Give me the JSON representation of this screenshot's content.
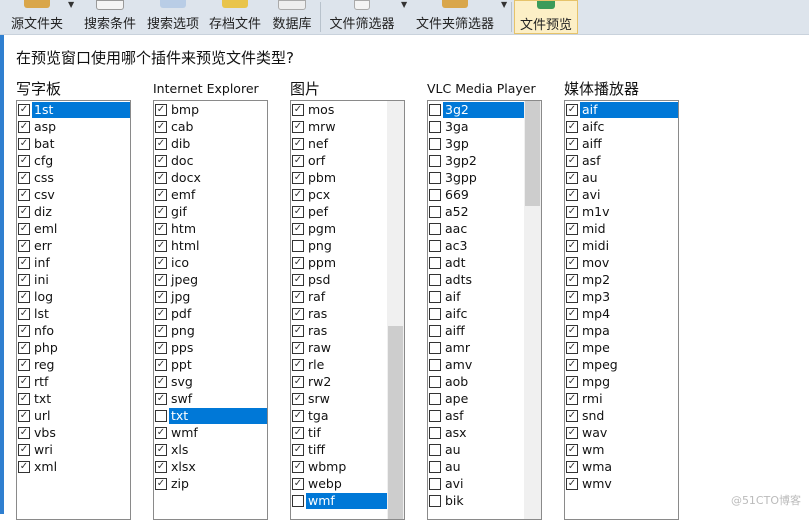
{
  "toolbar": {
    "items": [
      {
        "label": "源文件夹",
        "icon": "folder-search-icon"
      },
      {
        "label": "搜索条件",
        "icon": "search-icon"
      },
      {
        "label": "搜索选项",
        "icon": "gear-icon"
      },
      {
        "label": "存档文件",
        "icon": "archive-icon"
      },
      {
        "label": "数据库",
        "icon": "database-icon"
      },
      {
        "label": "文件筛选器",
        "icon": "filter-icon"
      },
      {
        "label": "文件夹筛选器",
        "icon": "folder-filter-icon"
      },
      {
        "label": "文件预览",
        "icon": "preview-icon"
      }
    ]
  },
  "question": "在预览窗口使用哪个插件来预览文件类型?",
  "groups": [
    {
      "title": "写字板",
      "items": [
        [
          "1st",
          1,
          1
        ],
        [
          "asp",
          1
        ],
        [
          "bat",
          1
        ],
        [
          "cfg",
          1
        ],
        [
          "css",
          1
        ],
        [
          "csv",
          1
        ],
        [
          "diz",
          1
        ],
        [
          "eml",
          1
        ],
        [
          "err",
          1
        ],
        [
          "inf",
          1
        ],
        [
          "ini",
          1
        ],
        [
          "log",
          1
        ],
        [
          "lst",
          1
        ],
        [
          "nfo",
          1
        ],
        [
          "php",
          1
        ],
        [
          "reg",
          1
        ],
        [
          "rtf",
          1
        ],
        [
          "txt",
          1
        ],
        [
          "url",
          1
        ],
        [
          "vbs",
          1
        ],
        [
          "wri",
          1
        ],
        [
          "xml",
          1
        ]
      ]
    },
    {
      "title": "Internet Explorer",
      "items": [
        [
          "bmp",
          1
        ],
        [
          "cab",
          1
        ],
        [
          "dib",
          1
        ],
        [
          "doc",
          1
        ],
        [
          "docx",
          1
        ],
        [
          "emf",
          1
        ],
        [
          "gif",
          1
        ],
        [
          "htm",
          1
        ],
        [
          "html",
          1
        ],
        [
          "ico",
          1
        ],
        [
          "jpeg",
          1
        ],
        [
          "jpg",
          1
        ],
        [
          "pdf",
          1
        ],
        [
          "png",
          1
        ],
        [
          "pps",
          1
        ],
        [
          "ppt",
          1
        ],
        [
          "svg",
          1
        ],
        [
          "swf",
          1
        ],
        [
          "txt",
          0,
          1
        ],
        [
          "wmf",
          1
        ],
        [
          "xls",
          1
        ],
        [
          "xlsx",
          1
        ],
        [
          "zip",
          1
        ]
      ]
    },
    {
      "title": "图片",
      "items": [
        [
          "mos",
          1
        ],
        [
          "mrw",
          1
        ],
        [
          "nef",
          1
        ],
        [
          "orf",
          1
        ],
        [
          "pbm",
          1
        ],
        [
          "pcx",
          1
        ],
        [
          "pef",
          1
        ],
        [
          "pgm",
          1
        ],
        [
          "png",
          0
        ],
        [
          "ppm",
          1
        ],
        [
          "psd",
          1
        ],
        [
          "raf",
          1
        ],
        [
          "ras",
          1
        ],
        [
          "ras",
          1
        ],
        [
          "raw",
          1
        ],
        [
          "rle",
          1
        ],
        [
          "rw2",
          1
        ],
        [
          "srw",
          1
        ],
        [
          "tga",
          1
        ],
        [
          "tif",
          1
        ],
        [
          "tiff",
          1
        ],
        [
          "wbmp",
          1
        ],
        [
          "webp",
          1
        ],
        [
          "wmf",
          0,
          1
        ]
      ]
    },
    {
      "title": "VLC Media Player",
      "items": [
        [
          "3g2",
          0,
          1
        ],
        [
          "3ga",
          0
        ],
        [
          "3gp",
          0
        ],
        [
          "3gp2",
          0
        ],
        [
          "3gpp",
          0
        ],
        [
          "669",
          0
        ],
        [
          "a52",
          0
        ],
        [
          "aac",
          0
        ],
        [
          "ac3",
          0
        ],
        [
          "adt",
          0
        ],
        [
          "adts",
          0
        ],
        [
          "aif",
          0
        ],
        [
          "aifc",
          0
        ],
        [
          "aiff",
          0
        ],
        [
          "amr",
          0
        ],
        [
          "amv",
          0
        ],
        [
          "aob",
          0
        ],
        [
          "ape",
          0
        ],
        [
          "asf",
          0
        ],
        [
          "asx",
          0
        ],
        [
          "au",
          0
        ],
        [
          "au",
          0
        ],
        [
          "avi",
          0
        ],
        [
          "bik",
          0
        ]
      ]
    },
    {
      "title": "媒体播放器",
      "items": [
        [
          "aif",
          1,
          1
        ],
        [
          "aifc",
          1
        ],
        [
          "aiff",
          1
        ],
        [
          "asf",
          1
        ],
        [
          "au",
          1
        ],
        [
          "avi",
          1
        ],
        [
          "m1v",
          1
        ],
        [
          "mid",
          1
        ],
        [
          "midi",
          1
        ],
        [
          "mov",
          1
        ],
        [
          "mp2",
          1
        ],
        [
          "mp3",
          1
        ],
        [
          "mp4",
          1
        ],
        [
          "mpa",
          1
        ],
        [
          "mpe",
          1
        ],
        [
          "mpeg",
          1
        ],
        [
          "mpg",
          1
        ],
        [
          "rmi",
          1
        ],
        [
          "snd",
          1
        ],
        [
          "wav",
          1
        ],
        [
          "wm",
          1
        ],
        [
          "wma",
          1
        ],
        [
          "wmv",
          1
        ]
      ]
    }
  ],
  "watermark": "@51CTO博客",
  "colors": {
    "selection": "#0078d7",
    "toolbar": "#dde4ec",
    "active_tab": "#fcefc6"
  }
}
